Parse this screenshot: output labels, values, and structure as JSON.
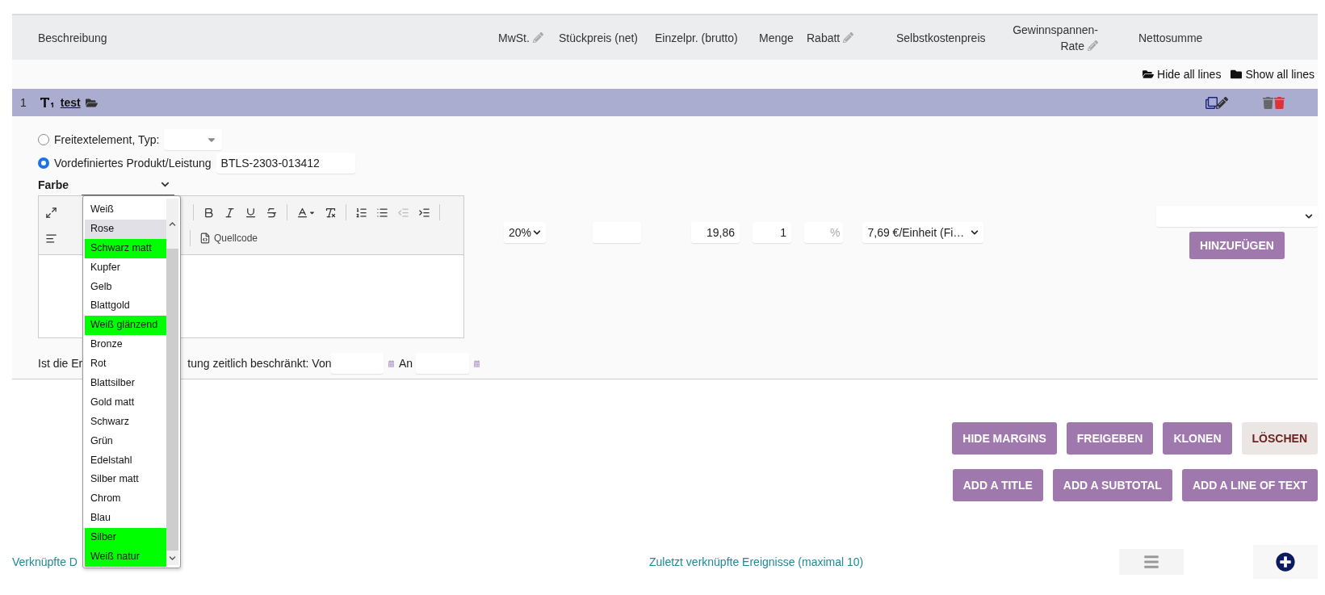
{
  "header": {
    "columns": [
      {
        "label": "Beschreibung",
        "editable": false
      },
      {
        "label": "MwSt.",
        "editable": true
      },
      {
        "label": "Stückpreis (net)",
        "editable": false
      },
      {
        "label": "Einzelpr. (brutto)",
        "editable": false
      },
      {
        "label": "Menge",
        "editable": false
      },
      {
        "label": "Rabatt",
        "editable": true
      },
      {
        "label": "Selbstkostenpreis",
        "editable": false
      },
      {
        "label": "Gewinnspannen-Rate",
        "editable": true
      },
      {
        "label": "Nettosumme",
        "editable": false
      }
    ]
  },
  "line_controls": [
    {
      "label": "Hide all lines",
      "kind": "open"
    },
    {
      "label": "Show all lines",
      "kind": "closed"
    }
  ],
  "line": {
    "number": "1",
    "title": "test"
  },
  "item_type": [
    {
      "label": "Freitextelement, Typ:",
      "selected": false
    },
    {
      "label": "Vordefiniertes Produkt/Leistung",
      "selected": true,
      "value": "BTLS-2303-013412"
    }
  ],
  "farbe": {
    "label": "Farbe",
    "expanded": true,
    "options": [
      {
        "label": "Weiß",
        "selected": false
      },
      {
        "label": "Rose",
        "selected": true
      },
      {
        "label": "Schwarz matt",
        "selected": false,
        "color": "#00ff00"
      },
      {
        "label": "Kupfer",
        "selected": false
      },
      {
        "label": "Gelb",
        "selected": false
      },
      {
        "label": "Blattgold",
        "selected": false
      },
      {
        "label": "Weiß glänzend",
        "selected": false,
        "color": "#00ff00"
      },
      {
        "label": "Bronze",
        "selected": false
      },
      {
        "label": "Rot",
        "selected": false
      },
      {
        "label": "Blattsilber",
        "selected": false
      },
      {
        "label": "Gold matt",
        "selected": false
      },
      {
        "label": "Schwarz",
        "selected": false
      },
      {
        "label": "Grün",
        "selected": false
      },
      {
        "label": "Edelstahl",
        "selected": false
      },
      {
        "label": "Silber matt",
        "selected": false
      },
      {
        "label": "Chrom",
        "selected": false
      },
      {
        "label": "Blau",
        "selected": false
      },
      {
        "label": "Silber",
        "selected": false,
        "color": "#00ff00"
      },
      {
        "label": "Weiß natur",
        "selected": false,
        "color": "#00ff00"
      }
    ]
  },
  "editor": {
    "source_button": "Quellcode"
  },
  "validity": {
    "text_before": "Ist die Er",
    "text_after": "tung zeitlich beschränkt: Von",
    "to_label": "An"
  },
  "pricing": {
    "vat": "20%",
    "unit_price_gross": "19,86",
    "quantity": "1",
    "discount_unit": "%",
    "cost_price": "7,69 €/Einheit (Fi…"
  },
  "add_button": "HINZUFÜGEN",
  "actions": [
    [
      {
        "label": "HIDE MARGINS",
        "kind": "primary"
      },
      {
        "label": "FREIGEBEN",
        "kind": "primary"
      },
      {
        "label": "KLONEN",
        "kind": "primary"
      },
      {
        "label": "LÖSCHEN",
        "kind": "danger"
      }
    ],
    [
      {
        "label": "ADD A TITLE",
        "kind": "primary"
      },
      {
        "label": "ADD A SUBTOTAL",
        "kind": "primary"
      },
      {
        "label": "ADD A LINE OF TEXT",
        "kind": "primary"
      }
    ]
  ],
  "footer": {
    "linked_left": "Verknüpfte D",
    "linked_events": "Zuletzt verknüpfte Ereignisse (maximal 10)"
  }
}
